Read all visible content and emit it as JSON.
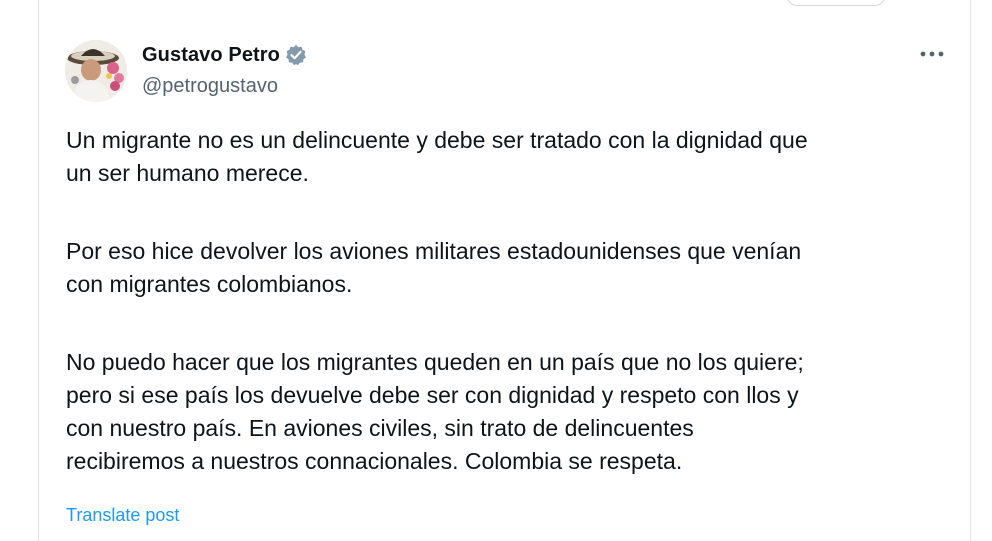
{
  "colors": {
    "accent": "#1d9bf0",
    "text_primary": "#0f1419",
    "text_secondary": "#536471",
    "verified_badge": "#829aab"
  },
  "author": {
    "display_name": "Gustavo Petro",
    "handle": "@petrogustavo",
    "verified_icon": "verified-badge-icon",
    "avatar_icon": "avatar"
  },
  "menu": {
    "more_icon": "more-options-icon"
  },
  "tweet": {
    "paragraphs": [
      "Un migrante no es un delincuente y debe ser tratado con la dignidad que\nun ser humano merece.",
      "Por eso hice devolver los aviones militares estadounidenses que venían\ncon migrantes colombianos.",
      "No puedo hacer que los migrantes queden en un país que no los quiere;\npero si ese país los devuelve debe ser con dignidad y respeto con llos y\ncon nuestro país. En aviones civiles, sin trato de delincuentes\nrecibiremos a nuestros connacionales. Colombia se respeta."
    ],
    "translate_label": "Translate post"
  }
}
